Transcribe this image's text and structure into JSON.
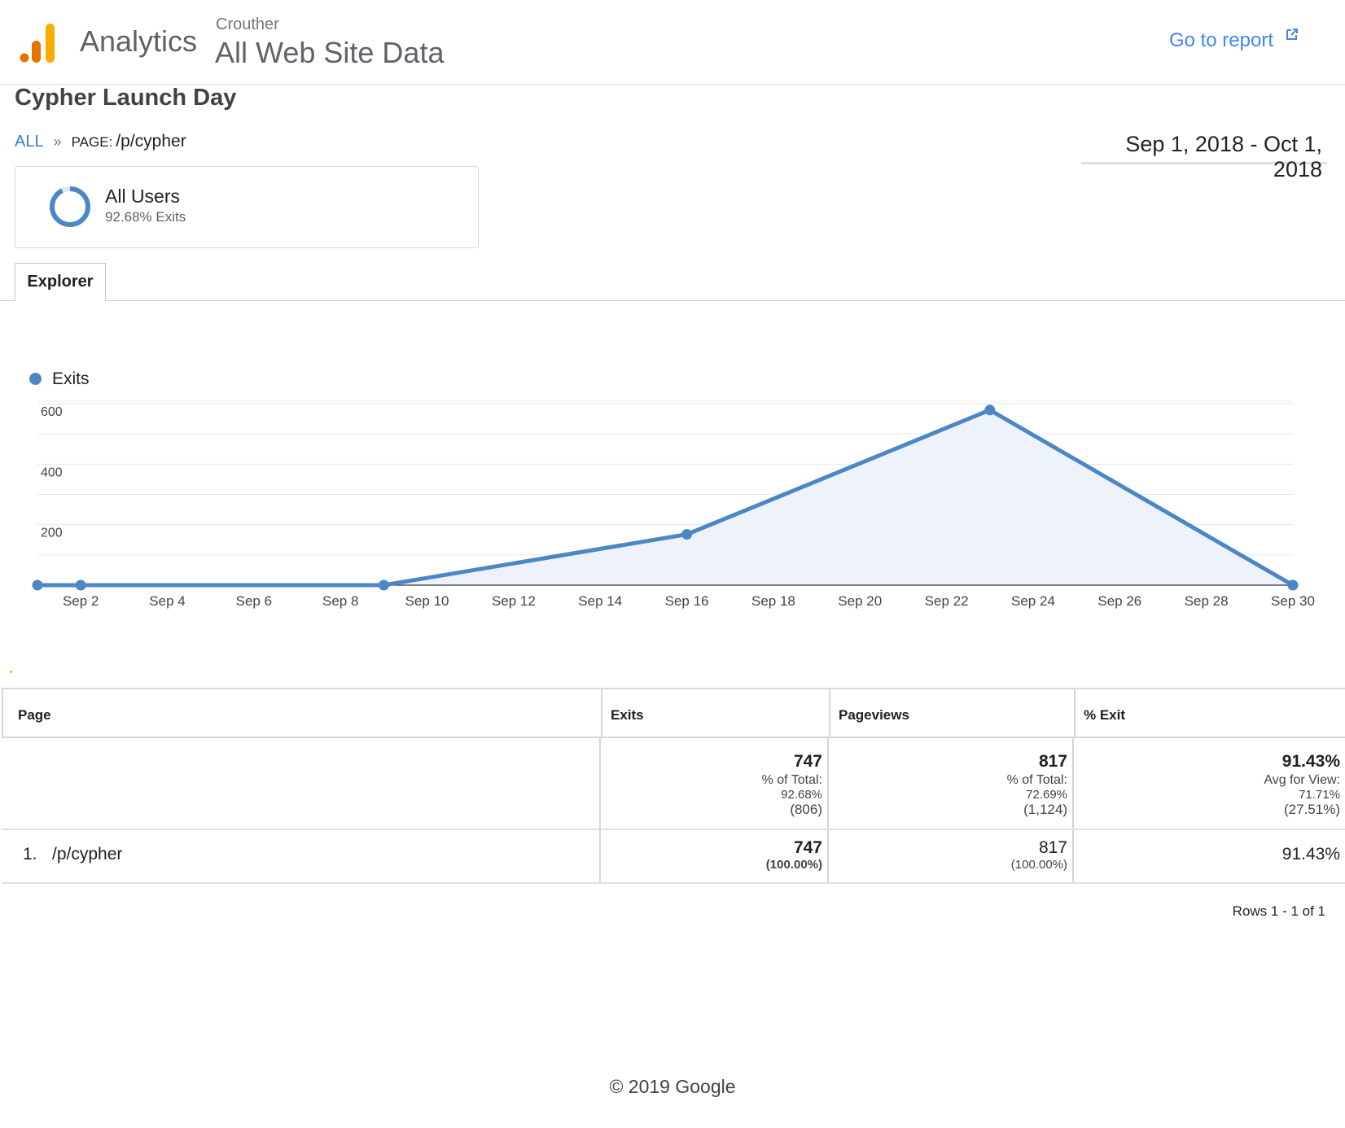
{
  "header": {
    "brand": "Analytics",
    "account": "Crouther",
    "property": "All Web Site Data",
    "go_to_report": "Go to report"
  },
  "report": {
    "title": "Cypher Launch Day",
    "breadcrumb": {
      "all": "ALL",
      "separator": "»",
      "dimension": "PAGE:",
      "value": "/p/cypher"
    },
    "date_range": "Sep 1, 2018 - Oct 1, 2018"
  },
  "segment": {
    "name": "All Users",
    "metric": "92.68% Exits",
    "fraction": 0.9268
  },
  "tabs": [
    {
      "label": "Explorer",
      "active": true
    }
  ],
  "chart_data": {
    "type": "area",
    "series": [
      {
        "name": "Exits",
        "color": "#4c87c5",
        "x": [
          "Sep 1",
          "Sep 2",
          "Sep 9",
          "Sep 16",
          "Sep 23",
          "Sep 30"
        ],
        "values": [
          0,
          0,
          0,
          168,
          579,
          0
        ]
      }
    ],
    "x_ticks": [
      "Sep 2",
      "Sep 4",
      "Sep 6",
      "Sep 8",
      "Sep 10",
      "Sep 12",
      "Sep 14",
      "Sep 16",
      "Sep 18",
      "Sep 20",
      "Sep 22",
      "Sep 24",
      "Sep 26",
      "Sep 28",
      "Sep 30"
    ],
    "y_ticks": [
      "600",
      "400",
      "200"
    ],
    "ylim": [
      0,
      600
    ],
    "grid": true,
    "legend": "top-left"
  },
  "table": {
    "columns": [
      "Page",
      "Exits",
      "Pageviews",
      "% Exit"
    ],
    "totals": {
      "exits": {
        "value": "747",
        "label": "% of Total:",
        "pct": "92.68%",
        "abs": "(806)"
      },
      "pageviews": {
        "value": "817",
        "label": "% of Total:",
        "pct": "72.69%",
        "abs": "(1,124)"
      },
      "exit_rate": {
        "value": "91.43%",
        "label": "Avg for View:",
        "pct": "71.71%",
        "abs": "(27.51%)"
      }
    },
    "rows": [
      {
        "index": "1.",
        "page": "/p/cypher",
        "exits": "747",
        "exits_pct": "(100.00%)",
        "pageviews": "817",
        "pageviews_pct": "(100.00%)",
        "exit_rate": "91.43%"
      }
    ],
    "rows_info": "Rows 1 - 1 of 1"
  },
  "footer": "© 2019 Google"
}
